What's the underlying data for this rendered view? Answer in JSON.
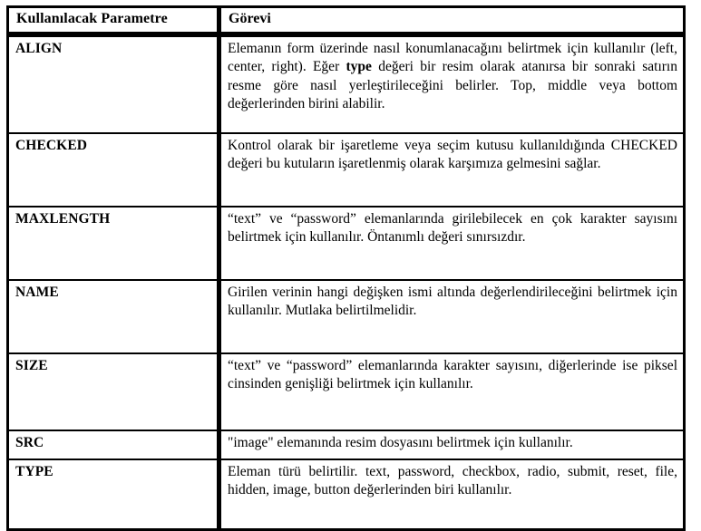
{
  "table": {
    "headers": {
      "parameter": "Kullanılacak Parametre",
      "task": "Görevi"
    },
    "rows": [
      {
        "parameter": "ALIGN",
        "description_pre": "Elemanın form üzerinde nasıl konumlanacağını belirtmek için kullanılır (left, center, right). Eğer ",
        "description_bold": "type",
        "description_post": " değeri bir resim olarak atanırsa bir sonraki satırın resme göre nasıl yerleştirileceğini belirler. Top, middle veya bottom değerlerinden birini alabilir.",
        "justified": true
      },
      {
        "parameter": "CHECKED",
        "description": "Kontrol olarak bir işaretleme veya seçim kutusu kullanıldığında CHECKED değeri bu kutuların işaretlenmiş olarak karşımıza gelmesini sağlar.",
        "justified": true
      },
      {
        "parameter": "MAXLENGTH",
        "description": "“text” ve “password” elemanlarında girilebilecek en çok karakter sayısını belirtmek için kullanılır. Öntanımlı değeri sınırsızdır.",
        "justified": true
      },
      {
        "parameter": "NAME",
        "description": "Girilen verinin hangi değişken ismi altında değerlendirileceğini belirtmek için kullanılır. Mutlaka belirtilmelidir.",
        "justified": true
      },
      {
        "parameter": "SIZE",
        "description": "“text” ve “password” elemanlarında karakter sayısını, diğerlerinde ise piksel cinsinden genişliği belirtmek için kullanılır.",
        "justified": true
      },
      {
        "parameter": "SRC",
        "description": "\"image\" elemanında resim dosyasını belirtmek için kullanılır.",
        "justified": false
      },
      {
        "parameter": "TYPE",
        "description": "Eleman türü belirtilir. text, password, checkbox, radio, submit, reset, file, hidden, image, button değerlerinden biri kullanılır.",
        "justified": true
      }
    ]
  },
  "colors": {
    "border": "#000000",
    "background": "#ffffff",
    "text": "#000000"
  }
}
